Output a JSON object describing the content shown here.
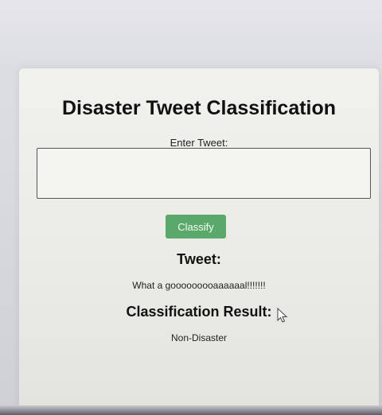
{
  "page": {
    "title": "Disaster Tweet Classification",
    "input_label": "Enter Tweet:",
    "input_value": "",
    "classify_button": "Classify",
    "tweet_heading": "Tweet:",
    "tweet_text": "What a gooooooooaaaaaal!!!!!!!",
    "result_heading": "Classification Result:",
    "result_text": "Non-Disaster"
  },
  "colors": {
    "button_bg": "#5aa86a",
    "card_bg": "#efefeb"
  },
  "icons": {
    "cursor": "mouse-pointer-icon"
  }
}
